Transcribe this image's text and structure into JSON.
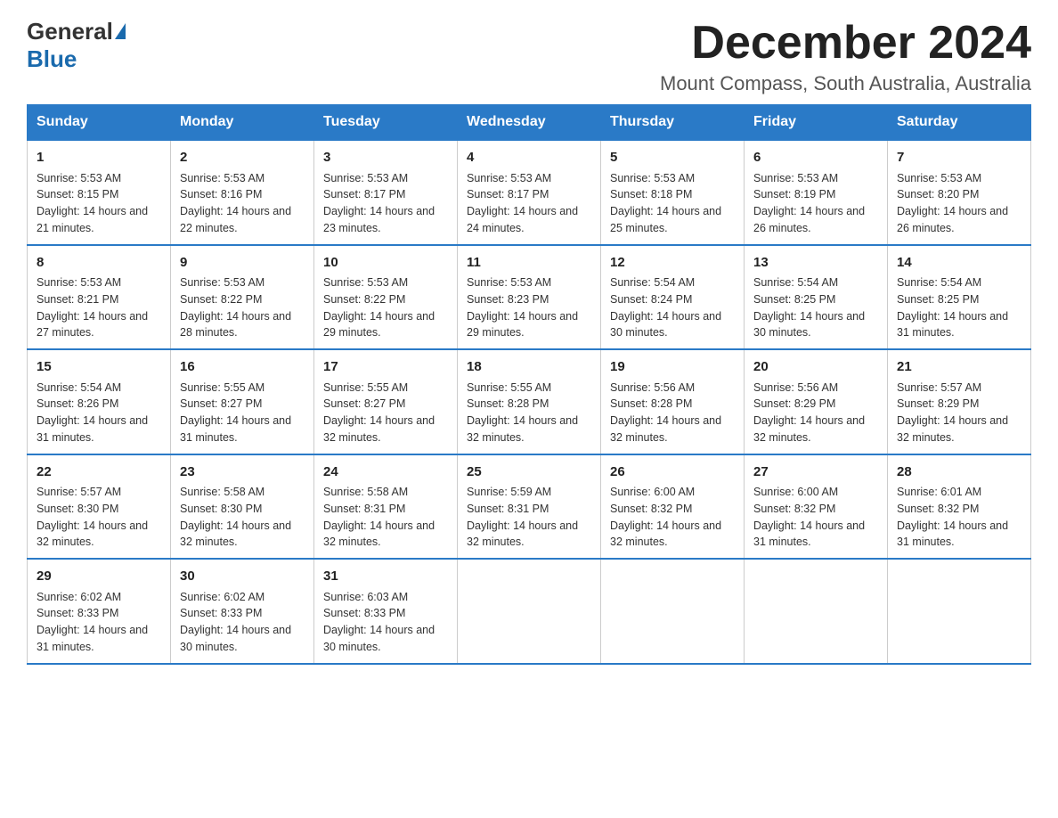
{
  "logo": {
    "general": "General",
    "blue": "Blue"
  },
  "title": {
    "month": "December 2024",
    "location": "Mount Compass, South Australia, Australia"
  },
  "weekdays": [
    "Sunday",
    "Monday",
    "Tuesday",
    "Wednesday",
    "Thursday",
    "Friday",
    "Saturday"
  ],
  "weeks": [
    [
      {
        "day": "1",
        "sunrise": "5:53 AM",
        "sunset": "8:15 PM",
        "daylight": "14 hours and 21 minutes."
      },
      {
        "day": "2",
        "sunrise": "5:53 AM",
        "sunset": "8:16 PM",
        "daylight": "14 hours and 22 minutes."
      },
      {
        "day": "3",
        "sunrise": "5:53 AM",
        "sunset": "8:17 PM",
        "daylight": "14 hours and 23 minutes."
      },
      {
        "day": "4",
        "sunrise": "5:53 AM",
        "sunset": "8:17 PM",
        "daylight": "14 hours and 24 minutes."
      },
      {
        "day": "5",
        "sunrise": "5:53 AM",
        "sunset": "8:18 PM",
        "daylight": "14 hours and 25 minutes."
      },
      {
        "day": "6",
        "sunrise": "5:53 AM",
        "sunset": "8:19 PM",
        "daylight": "14 hours and 26 minutes."
      },
      {
        "day": "7",
        "sunrise": "5:53 AM",
        "sunset": "8:20 PM",
        "daylight": "14 hours and 26 minutes."
      }
    ],
    [
      {
        "day": "8",
        "sunrise": "5:53 AM",
        "sunset": "8:21 PM",
        "daylight": "14 hours and 27 minutes."
      },
      {
        "day": "9",
        "sunrise": "5:53 AM",
        "sunset": "8:22 PM",
        "daylight": "14 hours and 28 minutes."
      },
      {
        "day": "10",
        "sunrise": "5:53 AM",
        "sunset": "8:22 PM",
        "daylight": "14 hours and 29 minutes."
      },
      {
        "day": "11",
        "sunrise": "5:53 AM",
        "sunset": "8:23 PM",
        "daylight": "14 hours and 29 minutes."
      },
      {
        "day": "12",
        "sunrise": "5:54 AM",
        "sunset": "8:24 PM",
        "daylight": "14 hours and 30 minutes."
      },
      {
        "day": "13",
        "sunrise": "5:54 AM",
        "sunset": "8:25 PM",
        "daylight": "14 hours and 30 minutes."
      },
      {
        "day": "14",
        "sunrise": "5:54 AM",
        "sunset": "8:25 PM",
        "daylight": "14 hours and 31 minutes."
      }
    ],
    [
      {
        "day": "15",
        "sunrise": "5:54 AM",
        "sunset": "8:26 PM",
        "daylight": "14 hours and 31 minutes."
      },
      {
        "day": "16",
        "sunrise": "5:55 AM",
        "sunset": "8:27 PM",
        "daylight": "14 hours and 31 minutes."
      },
      {
        "day": "17",
        "sunrise": "5:55 AM",
        "sunset": "8:27 PM",
        "daylight": "14 hours and 32 minutes."
      },
      {
        "day": "18",
        "sunrise": "5:55 AM",
        "sunset": "8:28 PM",
        "daylight": "14 hours and 32 minutes."
      },
      {
        "day": "19",
        "sunrise": "5:56 AM",
        "sunset": "8:28 PM",
        "daylight": "14 hours and 32 minutes."
      },
      {
        "day": "20",
        "sunrise": "5:56 AM",
        "sunset": "8:29 PM",
        "daylight": "14 hours and 32 minutes."
      },
      {
        "day": "21",
        "sunrise": "5:57 AM",
        "sunset": "8:29 PM",
        "daylight": "14 hours and 32 minutes."
      }
    ],
    [
      {
        "day": "22",
        "sunrise": "5:57 AM",
        "sunset": "8:30 PM",
        "daylight": "14 hours and 32 minutes."
      },
      {
        "day": "23",
        "sunrise": "5:58 AM",
        "sunset": "8:30 PM",
        "daylight": "14 hours and 32 minutes."
      },
      {
        "day": "24",
        "sunrise": "5:58 AM",
        "sunset": "8:31 PM",
        "daylight": "14 hours and 32 minutes."
      },
      {
        "day": "25",
        "sunrise": "5:59 AM",
        "sunset": "8:31 PM",
        "daylight": "14 hours and 32 minutes."
      },
      {
        "day": "26",
        "sunrise": "6:00 AM",
        "sunset": "8:32 PM",
        "daylight": "14 hours and 32 minutes."
      },
      {
        "day": "27",
        "sunrise": "6:00 AM",
        "sunset": "8:32 PM",
        "daylight": "14 hours and 31 minutes."
      },
      {
        "day": "28",
        "sunrise": "6:01 AM",
        "sunset": "8:32 PM",
        "daylight": "14 hours and 31 minutes."
      }
    ],
    [
      {
        "day": "29",
        "sunrise": "6:02 AM",
        "sunset": "8:33 PM",
        "daylight": "14 hours and 31 minutes."
      },
      {
        "day": "30",
        "sunrise": "6:02 AM",
        "sunset": "8:33 PM",
        "daylight": "14 hours and 30 minutes."
      },
      {
        "day": "31",
        "sunrise": "6:03 AM",
        "sunset": "8:33 PM",
        "daylight": "14 hours and 30 minutes."
      },
      null,
      null,
      null,
      null
    ]
  ],
  "labels": {
    "sunrise": "Sunrise: ",
    "sunset": "Sunset: ",
    "daylight": "Daylight: "
  }
}
